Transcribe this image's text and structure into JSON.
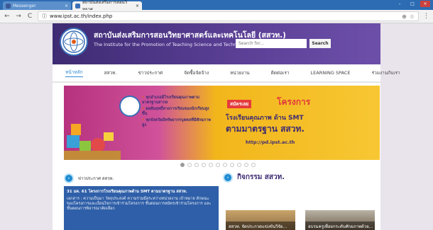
{
  "browser": {
    "tabs": [
      {
        "label": "Messenger",
        "active": false,
        "favicon_color": "#3b5998"
      },
      {
        "label": "สถาบันส่งเสริมการสอนวิทยาศ...",
        "active": true,
        "favicon_color": "#3a6fb7"
      }
    ],
    "tab_close_glyph": "×",
    "window_controls": {
      "minimize": "–",
      "maximize": "□",
      "close": "×"
    },
    "nav": {
      "back": "←",
      "forward": "→",
      "reload": "C"
    },
    "url": "www.ipst.ac.th/index.php",
    "url_icons": {
      "secure": "ⓘ",
      "zoom": "⊕",
      "star": "☆"
    },
    "menu": "⋮"
  },
  "site": {
    "org_name_th": "สถาบันส่งเสริมการสอนวิทยาศาสตร์และเทคโนโลยี (สสวท.)",
    "org_name_en": "The Institute for the Promotion of Teaching Science and Technology (IPST)",
    "search": {
      "placeholder": "Search for...",
      "button": "Search"
    },
    "nav_items": [
      {
        "label": "หน้าหลัก",
        "active": true
      },
      {
        "label": "สสวท.",
        "active": false
      },
      {
        "label": "ข่าวประกาศ",
        "active": false
      },
      {
        "label": "จัดซื้อจัดจ้าง",
        "active": false
      },
      {
        "label": "หน่วยงาน",
        "active": false
      },
      {
        "label": "ติดต่อเรา",
        "active": false
      },
      {
        "label": "LEARNING SPACE",
        "active": false
      },
      {
        "label": "ร่วมงานกับเรา",
        "active": false
      }
    ],
    "banner": {
      "bullets": [
        "ทุกอำเภอมีโรงเรียนคุณภาพตามมาตรฐานสากล",
        "ผลสัมฤทธิ์ทางการเรียนของนักเรียนสูงขึ้น",
        "ทุกจังหวัดมีทรัพยากรบุคคลที่มีศักยภาพสูง"
      ],
      "apply_label": "สมัครเลย",
      "project_label": "โครงการ",
      "line1": "โรงเรียนคุณภาพ ด้าน SMT",
      "line2": "ตามมาตรฐาน สสวท.",
      "url": "http://pd.ipst.ac.th",
      "slide_count": 11,
      "active_slide": 0
    },
    "news": {
      "title": "ข่าวประกาศ สสวท.",
      "headline": "31 มค. 61 โครงการโรงเรียนคุณภาพด้าน SMT ตามมาตรฐาน สสวท.",
      "body": "เอกสาร : ความเป็นมา วัตถุประสงค์ ความร่วมมือระหว่างหน่วยงาน เป้าหมาย ลักษณะของโครงการและเงื่อนไขการเข้าร่วมโครงการ ขั้นตอนการสมัครเข้าร่วมโครงการ และขั้นตอนการพิจารณาคัดเลือก"
    },
    "activities": {
      "title": "กิจกรรม สสวท.",
      "photos": [
        {
          "caption": "สสวท. จัดประกวดแข่งขันวิจัย..."
        },
        {
          "caption": "อบรมครูเพื่อยกระดับศักยภาพด้วย..."
        }
      ]
    }
  },
  "colors": {
    "tabstrip": "#2d6cb3",
    "header_purple": "#3e2b73",
    "nav_active": "#2e8bd6",
    "news_box": "#2f5fa8",
    "side_bg": "#e9e4ec"
  }
}
